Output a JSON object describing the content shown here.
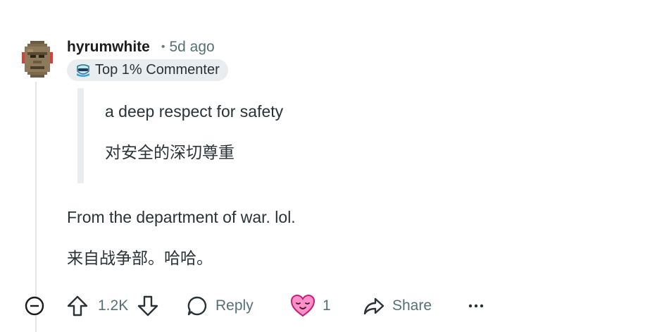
{
  "comment": {
    "username": "hyrumwhite",
    "separator": "•",
    "time": "5d ago",
    "flair": "Top 1% Commenter",
    "quote_lines": [
      "a deep respect for safety",
      "对安全的深切尊重"
    ],
    "body_lines": [
      "From the department of war. lol.",
      "来自战争部。哈哈。"
    ]
  },
  "actions": {
    "collapse_icon": "minus-circle-icon",
    "upvote_icon": "upvote-arrow-icon",
    "vote_count": "1.2K",
    "downvote_icon": "downvote-arrow-icon",
    "reply_label": "Reply",
    "award_icon": "heart-face-award-icon",
    "award_count": "1",
    "share_label": "Share",
    "more_icon": "ellipsis-icon"
  },
  "colors": {
    "text": "#2a3236",
    "muted": "#576f76",
    "flair_bg": "#eaedef",
    "thread_line": "#e3e6e8",
    "award_pink": "#ff4fa3"
  }
}
